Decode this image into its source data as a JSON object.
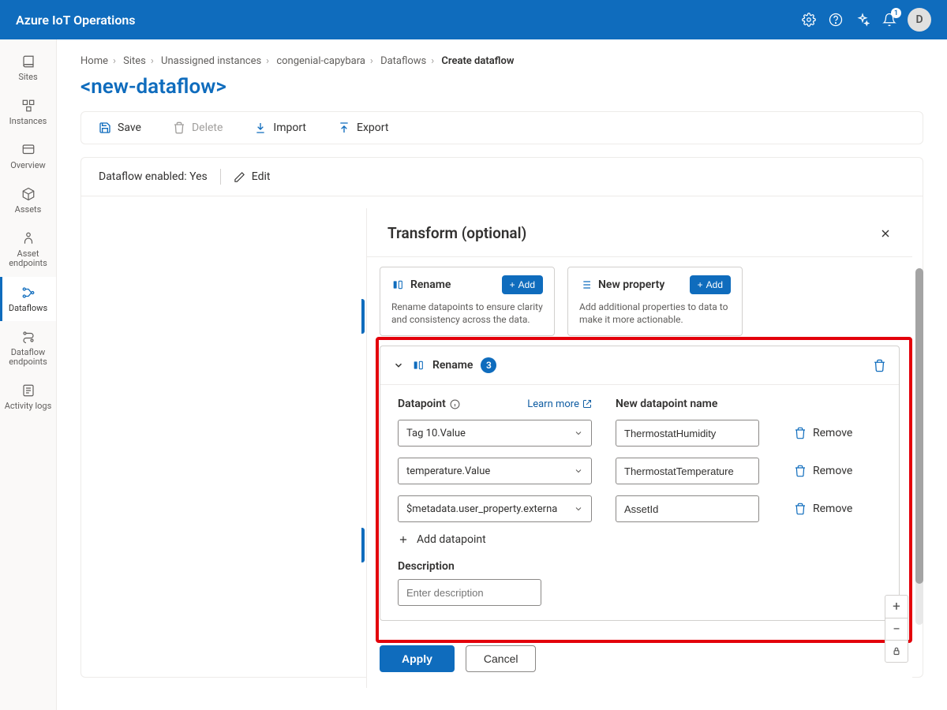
{
  "app_title": "Azure IoT Operations",
  "notification_badge": "1",
  "avatar_initial": "D",
  "nav": {
    "sites": "Sites",
    "instances": "Instances",
    "overview": "Overview",
    "assets": "Assets",
    "asset_endpoints": "Asset endpoints",
    "dataflows": "Dataflows",
    "dataflow_endpoints": "Dataflow endpoints",
    "activity_logs": "Activity logs"
  },
  "breadcrumb": {
    "home": "Home",
    "sites": "Sites",
    "unassigned": "Unassigned instances",
    "instance": "congenial-capybara",
    "dataflows": "Dataflows",
    "current": "Create dataflow"
  },
  "page_title": "<new-dataflow>",
  "toolbar": {
    "save": "Save",
    "delete": "Delete",
    "import": "Import",
    "export": "Export"
  },
  "enabled": {
    "label": "Dataflow enabled: ",
    "value": "Yes",
    "edit": "Edit"
  },
  "panel": {
    "title": "Transform (optional)",
    "rename_card": {
      "title": "Rename",
      "add": "Add",
      "desc": "Rename datapoints to ensure clarity and consistency across the data."
    },
    "newprop_card": {
      "title": "New property",
      "add": "Add",
      "desc": "Add additional properties to data to make it more actionable."
    },
    "rename_block": {
      "title": "Rename",
      "count": "3",
      "datapoint_label": "Datapoint",
      "learn_more": "Learn more",
      "new_name_label": "New datapoint name",
      "rows": [
        {
          "dp": "Tag 10.Value",
          "name": "ThermostatHumidity"
        },
        {
          "dp": "temperature.Value",
          "name": "ThermostatTemperature"
        },
        {
          "dp": "$metadata.user_property.externa",
          "name": "AssetId"
        }
      ],
      "remove": "Remove",
      "add_dp": "Add datapoint",
      "desc_label": "Description",
      "desc_placeholder": "Enter description"
    },
    "apply": "Apply",
    "cancel": "Cancel"
  }
}
